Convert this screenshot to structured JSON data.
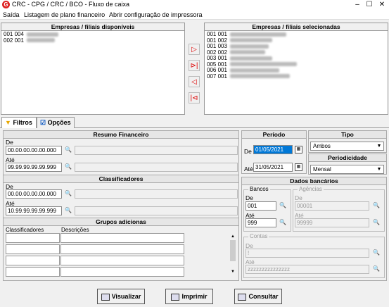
{
  "window": {
    "title": "CRC - CPG / CRC / BCO - Fluxo de caixa",
    "logo": "G",
    "min": "–",
    "max": "☐",
    "close": "✕"
  },
  "menu": [
    "Saída",
    "Listagem de plano financeiro",
    "Abrir configuração de impressora"
  ],
  "available": {
    "header": "Empresas / filiais disponíveis",
    "items": [
      "001 004",
      "002 001"
    ]
  },
  "selected": {
    "header": "Empresas / filiais selecionadas",
    "items": [
      "001 001",
      "001 002",
      "001 003",
      "002 002",
      "003 001",
      "005 001",
      "006 001",
      "007 001"
    ]
  },
  "arrows": {
    "add": "▷",
    "add_all": "⊳|",
    "remove": "◁",
    "remove_all": "|⊲"
  },
  "tabs": {
    "filtros": "Filtros",
    "opcoes": "Opções"
  },
  "resumo": {
    "header": "Resumo Financeiro",
    "de_label": "De",
    "de_value": "00.00.00.00.00.000",
    "ate_label": "Até",
    "ate_value": "99.99.99.99.99.999"
  },
  "classificadores": {
    "header": "Classificadores",
    "de_label": "De",
    "de_value": "00.00.00.00.00.000",
    "ate_label": "Até",
    "ate_value": "10.99.99.99.99.999"
  },
  "grupos": {
    "header": "Grupos adicionas",
    "col1": "Classificadores",
    "col2": "Descrições"
  },
  "periodo": {
    "header": "Período",
    "de_label": "De",
    "de_value": "01/05/2021",
    "ate_label": "Até",
    "ate_value": "31/05/2021"
  },
  "tipo": {
    "header": "Tipo",
    "value": "Ambos"
  },
  "periodicidade": {
    "header": "Periodicidade",
    "value": "Mensal"
  },
  "dados": {
    "header": "Dados bancários",
    "bancos": {
      "legend": "Bancos",
      "de_label": "De",
      "de_value": "001",
      "ate_label": "Até",
      "ate_value": "999"
    },
    "agencias": {
      "legend": "Agências",
      "de_label": "De",
      "de_value": "00001",
      "ate_label": "Até",
      "ate_value": "99999"
    },
    "contas": {
      "legend": "Contas",
      "de_label": "De",
      "de_value": "!",
      "ate_label": "Até",
      "ate_value": "zzzzzzzzzzzzzzz"
    }
  },
  "buttons": {
    "visualizar": "Visualizar",
    "imprimir": "Imprimir",
    "consultar": "Consultar"
  },
  "colors": {
    "arrow": "#d00000",
    "selection": "#0078d7"
  }
}
